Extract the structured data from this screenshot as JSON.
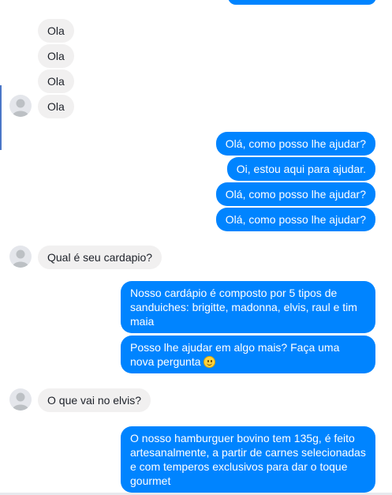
{
  "messages": {
    "incoming_1": "Ola",
    "incoming_2": "Ola",
    "incoming_3": "Ola",
    "incoming_4": "Ola",
    "outgoing_1": "Olá, como posso lhe ajudar?",
    "outgoing_2": "Oi, estou aqui para ajudar.",
    "outgoing_3": "Olá, como posso lhe ajudar?",
    "outgoing_4": "Olá, como posso lhe ajudar?",
    "incoming_5": "Qual é seu cardapio?",
    "outgoing_5": "Nosso cardápio é composto por 5 tipos de sanduiches: brigitte, madonna, elvis, raul e tim maia",
    "outgoing_6": "Posso lhe ajudar em algo mais? Faça uma nova pergunta",
    "incoming_6": "O que vai no elvis?",
    "outgoing_7": "O nosso hamburguer bovino tem 135g, é feito artesanalmente, a partir de carnes selecionadas e com temperos exclusivos para dar o toque gourmet"
  },
  "icons": {
    "avatar": "user-avatar-icon",
    "emoji": "smiley-emoji-icon"
  },
  "colors": {
    "outgoing_bubble": "#0084ff",
    "incoming_bubble": "#f1f0f0",
    "avatar": "#e4e6eb"
  }
}
